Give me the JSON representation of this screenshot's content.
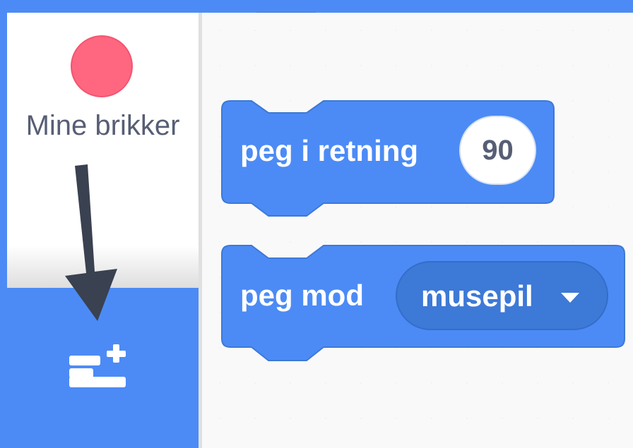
{
  "category": {
    "label": "Mine brikker",
    "color": "#ff6680"
  },
  "extension_button": {
    "icon": "add-extension-icon"
  },
  "blocks": [
    {
      "text": "peg i retning",
      "input_value": "90"
    },
    {
      "text": "peg mod",
      "dropdown_value": "musepil"
    }
  ],
  "colors": {
    "motion_block": "#4c8bf5",
    "motion_block_dark": "#3d79d6",
    "category_dot": "#ff6680",
    "workspace": "#f9f9f9",
    "arrow": "#3a4150"
  }
}
